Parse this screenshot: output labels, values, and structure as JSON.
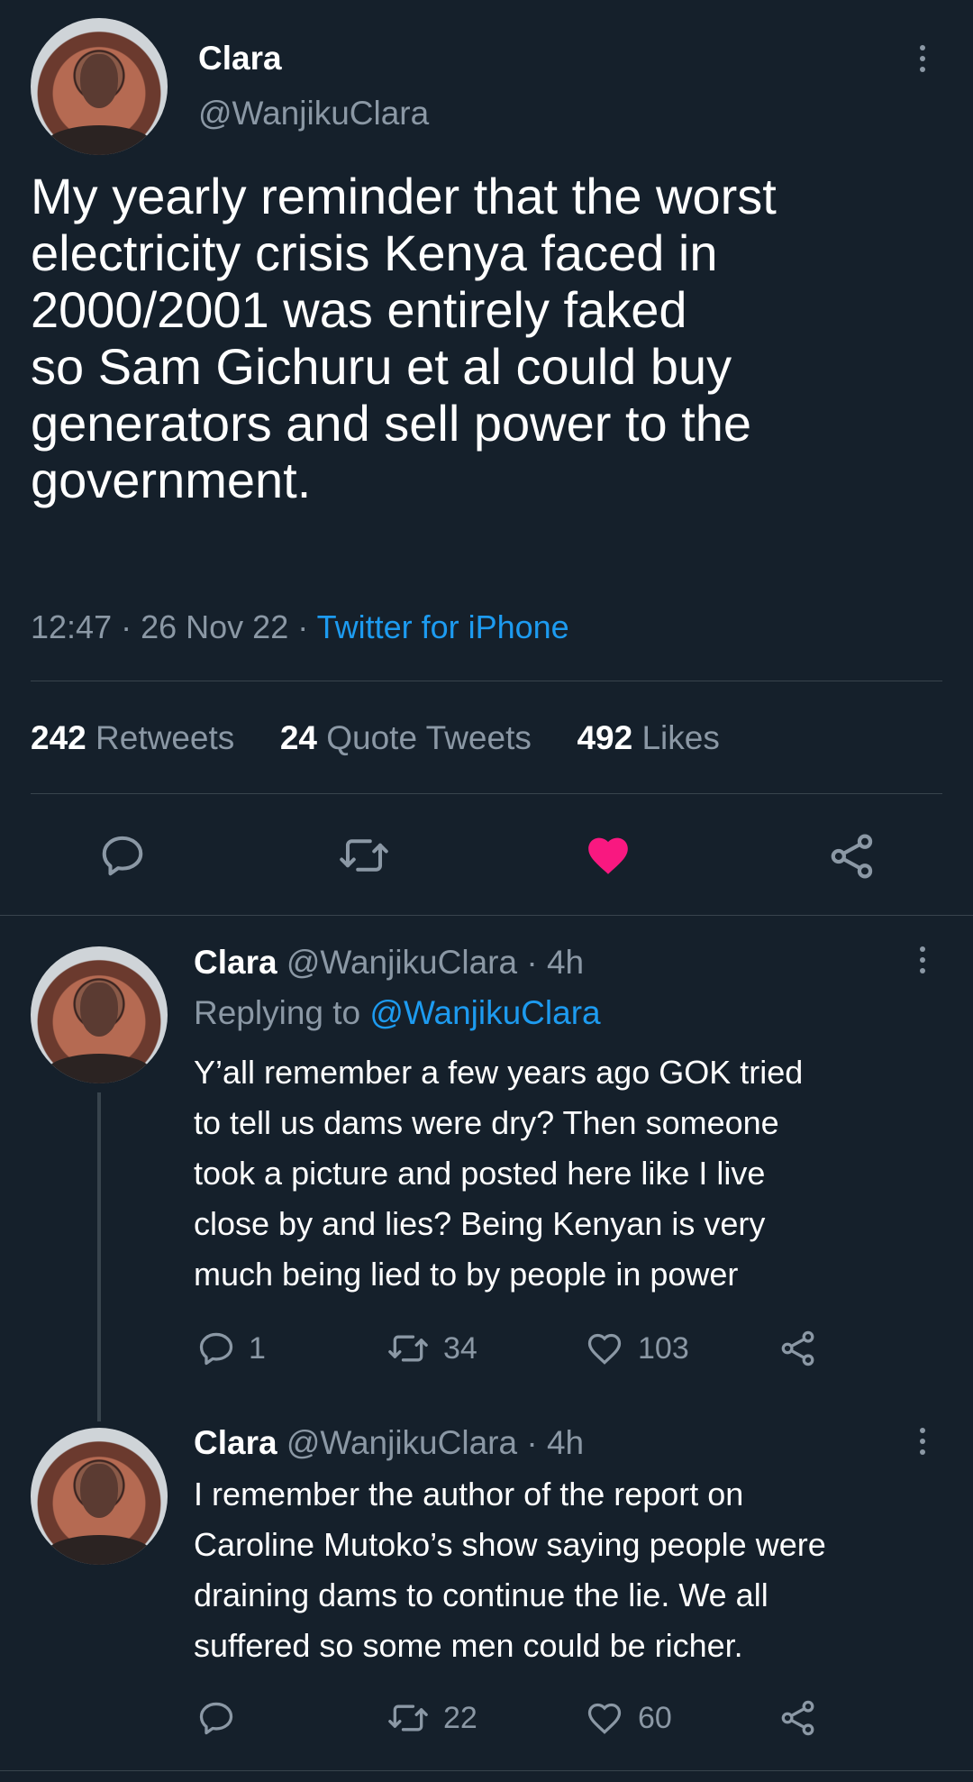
{
  "tweet": {
    "name": "Clara",
    "handle": "@WanjikuClara",
    "text_lines": [
      "My yearly reminder that the worst",
      "electricity crisis Kenya faced in",
      "2000/2001 was entirely faked",
      "so Sam Gichuru et al could buy",
      "generators and sell power to the",
      "government."
    ],
    "time": "12:47",
    "date": "26 Nov 22",
    "source": "Twitter for iPhone",
    "retweets_count": "242",
    "retweets_label": "Retweets",
    "quotes_count": "24",
    "quotes_label": "Quote Tweets",
    "likes_count": "492",
    "likes_label": "Likes",
    "liked": true,
    "like_color": "#f91880"
  },
  "replies": [
    {
      "name": "Clara",
      "handle": "@WanjikuClara",
      "age": "4h",
      "replying_prefix": "Replying to",
      "replying_handle": "@WanjikuClara",
      "text_lines": [
        "Y’all remember a few years ago GOK tried",
        "to tell us dams were dry? Then someone",
        "took a picture and posted here like I live",
        "close by and lies? Being Kenyan is very",
        "much being lied to by people in power"
      ],
      "reply_count": "1",
      "retweet_count": "34",
      "like_count": "103"
    },
    {
      "name": "Clara",
      "handle": "@WanjikuClara",
      "age": "4h",
      "text_lines": [
        "I remember the author of the report on",
        "Caroline Mutoko’s show saying people were",
        "draining dams to continue the lie. We all",
        "suffered so some men could be richer."
      ],
      "reply_count": "",
      "retweet_count": "22",
      "like_count": "60"
    }
  ],
  "colors": {
    "background": "#15202b",
    "accent": "#1d9bf0",
    "muted": "#8b98a5"
  },
  "icons": [
    "more-icon",
    "reply-icon",
    "retweet-icon",
    "heart-icon",
    "share-icon"
  ]
}
